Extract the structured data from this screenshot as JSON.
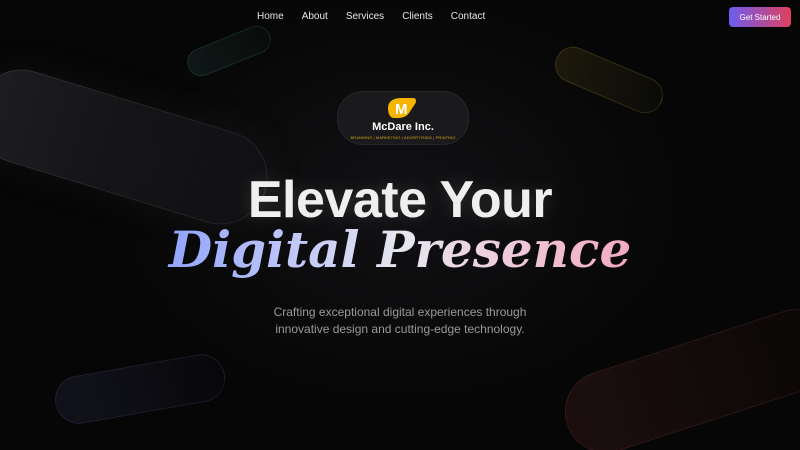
{
  "nav": {
    "items": [
      {
        "label": "Home"
      },
      {
        "label": "About"
      },
      {
        "label": "Services"
      },
      {
        "label": "Clients"
      },
      {
        "label": "Contact"
      }
    ],
    "cta_label": "Get Started"
  },
  "logo": {
    "mark_letter": "M",
    "name": "McDare Inc.",
    "tagline": "BRANDING | MARKETING | ADVERTISING | PRINTING"
  },
  "hero": {
    "heading_line1": "Elevate Your",
    "heading_line2": "Digital Presence",
    "subtitle_line1": "Crafting exceptional digital experiences through",
    "subtitle_line2": "innovative design and cutting-edge technology."
  },
  "colors": {
    "background": "#060606",
    "cta_gradient_start": "#6d5cf0",
    "cta_gradient_end": "#e0405e",
    "logo_yellow": "#f4b400",
    "tagline_gold": "#d9a21a"
  }
}
